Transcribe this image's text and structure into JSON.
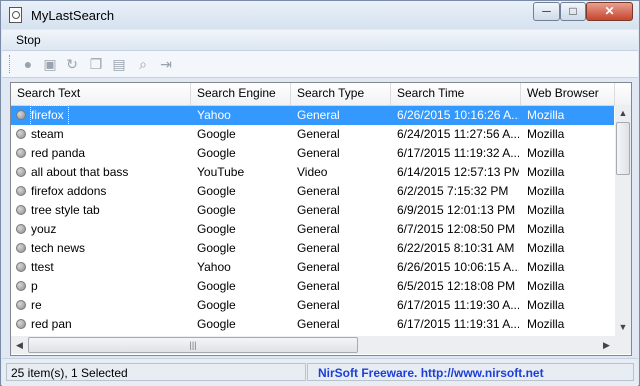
{
  "window": {
    "title": "MyLastSearch",
    "min_glyph": "─",
    "max_glyph": "□",
    "close_glyph": "✕"
  },
  "menu": {
    "items": [
      "Stop"
    ]
  },
  "toolbar": {
    "icons": [
      {
        "name": "stop-icon",
        "glyph": "●"
      },
      {
        "name": "save-icon",
        "glyph": "▣"
      },
      {
        "name": "refresh-icon",
        "glyph": "↻"
      },
      {
        "name": "copy-icon",
        "glyph": "❐"
      },
      {
        "name": "html-report-icon",
        "glyph": "▤"
      },
      {
        "name": "find-icon",
        "glyph": "⌕"
      },
      {
        "name": "exit-icon",
        "glyph": "⇥"
      }
    ]
  },
  "list": {
    "columns": [
      "Search Text",
      "Search Engine",
      "Search Type",
      "Search Time",
      "Web Browser"
    ],
    "rows": [
      {
        "text": "firefox",
        "engine": "Yahoo",
        "type": "General",
        "time": "6/26/2015 10:16:26 A...",
        "browser": "Mozilla",
        "selected": true
      },
      {
        "text": "steam",
        "engine": "Google",
        "type": "General",
        "time": "6/24/2015 11:27:56 A...",
        "browser": "Mozilla"
      },
      {
        "text": "red panda",
        "engine": "Google",
        "type": "General",
        "time": "6/17/2015 11:19:32 A...",
        "browser": "Mozilla"
      },
      {
        "text": "all about that bass",
        "engine": "YouTube",
        "type": "Video",
        "time": "6/14/2015 12:57:13 PM",
        "browser": "Mozilla"
      },
      {
        "text": "firefox addons",
        "engine": "Google",
        "type": "General",
        "time": "6/2/2015 7:15:32 PM",
        "browser": "Mozilla"
      },
      {
        "text": "tree style tab",
        "engine": "Google",
        "type": "General",
        "time": "6/9/2015 12:01:13 PM",
        "browser": "Mozilla"
      },
      {
        "text": "youz",
        "engine": "Google",
        "type": "General",
        "time": "6/7/2015 12:08:50 PM",
        "browser": "Mozilla"
      },
      {
        "text": "tech news",
        "engine": "Google",
        "type": "General",
        "time": "6/22/2015 8:10:31 AM",
        "browser": "Mozilla"
      },
      {
        "text": "ttest",
        "engine": "Yahoo",
        "type": "General",
        "time": "6/26/2015 10:06:15 A...",
        "browser": "Mozilla"
      },
      {
        "text": "p",
        "engine": "Google",
        "type": "General",
        "time": "6/5/2015 12:18:08 PM",
        "browser": "Mozilla"
      },
      {
        "text": "re",
        "engine": "Google",
        "type": "General",
        "time": "6/17/2015 11:19:30 A...",
        "browser": "Mozilla"
      },
      {
        "text": "red pan",
        "engine": "Google",
        "type": "General",
        "time": "6/17/2015 11:19:31 A...",
        "browser": "Mozilla"
      }
    ]
  },
  "scroll": {
    "up": "▲",
    "down": "▼",
    "left": "◀",
    "right": "▶",
    "grip": "|||"
  },
  "status": {
    "count": "25 item(s), 1 Selected",
    "credit": "NirSoft Freeware.  http://www.nirsoft.net"
  },
  "colors": {
    "selection": "#3399ff",
    "link": "#1c3fd6"
  }
}
